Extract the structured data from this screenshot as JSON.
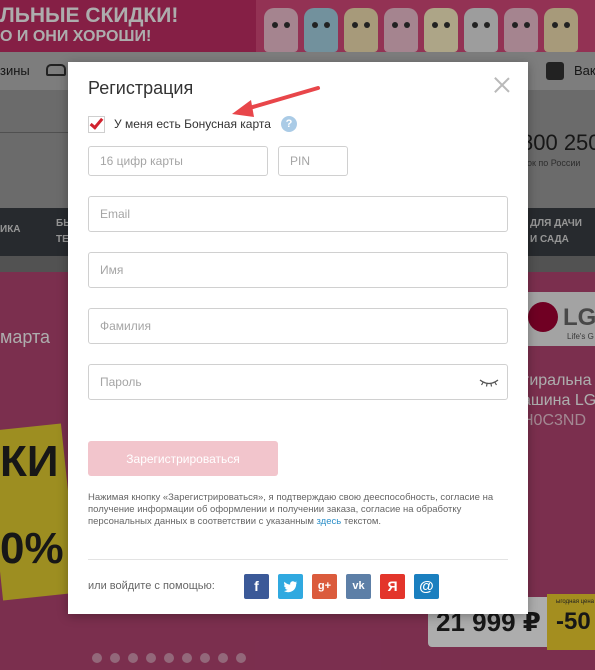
{
  "background": {
    "banner_line1": "ЛЬНЫЕ СКИДКИ!",
    "banner_line2": "О И ОНИ ХОРОШИ!",
    "nav_left": "зины",
    "nav_right": "Вак",
    "phone": "800 250",
    "phone_sub": "нок по России",
    "menu_left": "ИКА",
    "menu_mid_line1": "БЫ",
    "menu_mid_line2": "ТЕ",
    "menu_right_line1": "ДЛЯ ДАЧИ",
    "menu_right_line2": "И САДА",
    "promo_date": "марта",
    "sale_text": "КИ",
    "sale_percent": "0%",
    "brand": "LG",
    "brand_slogan": "Life's G",
    "product_line1": "тиральна",
    "product_line2": "ашина LG",
    "product_line3": "H0C3ND",
    "price": "21 999 ₽",
    "discount": "-50",
    "discount_sub": "ыгодная цена"
  },
  "modal": {
    "title": "Регистрация",
    "bonus_checkbox_label": "У меня есть Бонусная карта",
    "bonus_checked": true,
    "help_symbol": "?",
    "card_placeholder": "16 цифр карты",
    "pin_placeholder": "PIN",
    "email_placeholder": "Email",
    "name_placeholder": "Имя",
    "surname_placeholder": "Фамилия",
    "password_placeholder": "Пароль",
    "submit_label": "Зарегистрироваться",
    "legal_text": "Нажимая кнопку «Зарегистрироваться», я подтверждаю свою дееспособность, согласие на получение информации об оформлении и получении заказа, согласие на обработку персональных данных в соответствии с указанным",
    "legal_link": "здесь",
    "legal_suffix": "текстом.",
    "social_label": "или войдите с помощью:",
    "social": {
      "facebook": "f",
      "twitter": "🐦",
      "google": "g+",
      "vk": "vk",
      "yandex": "Я",
      "mail": "@"
    }
  },
  "colors": {
    "accent": "#d1222e",
    "submit_disabled": "#f2c5cc",
    "link": "#2d8fc8"
  }
}
